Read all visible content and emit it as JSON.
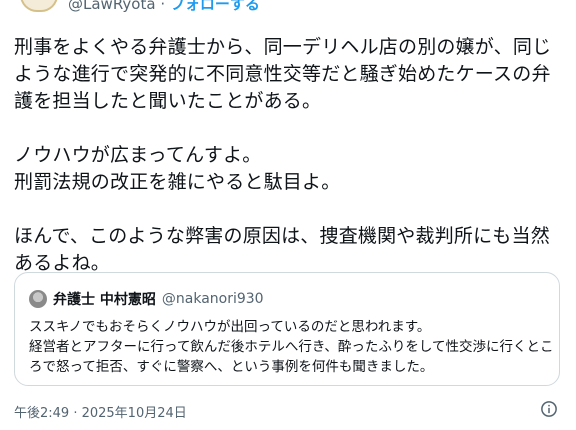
{
  "author": {
    "handle": "@LawRyota",
    "separator": " · ",
    "follow_label": "フォローする"
  },
  "tweet": {
    "text": "刑事をよくやる弁護士から、同一デリヘル店の別の嬢が、同じような進行で突発的に不同意性交等だと騒ぎ始めたケースの弁護を担当したと聞いたことがある。\n\nノウハウが広まってんすよ。\n刑罰法規の改正を雑にやると駄目よ。\n\nほんで、このような弊害の原因は、捜査機関や裁判所にも当然あるよね。"
  },
  "quote": {
    "name": "弁護士 中村憲昭",
    "handle": "@nakanori930",
    "text": "ススキノでもおそらくノウハウが出回っているのだと思われます。\n経営者とアフターに行って飲んだ後ホテルへ行き、酔ったふりをして性交渉に行くところで怒って拒否、すぐに警察へ、という事例を何件も聞きました。"
  },
  "timestamp": "午後2:49 · 2025年10月24日",
  "icons": {
    "info": "info-icon"
  }
}
